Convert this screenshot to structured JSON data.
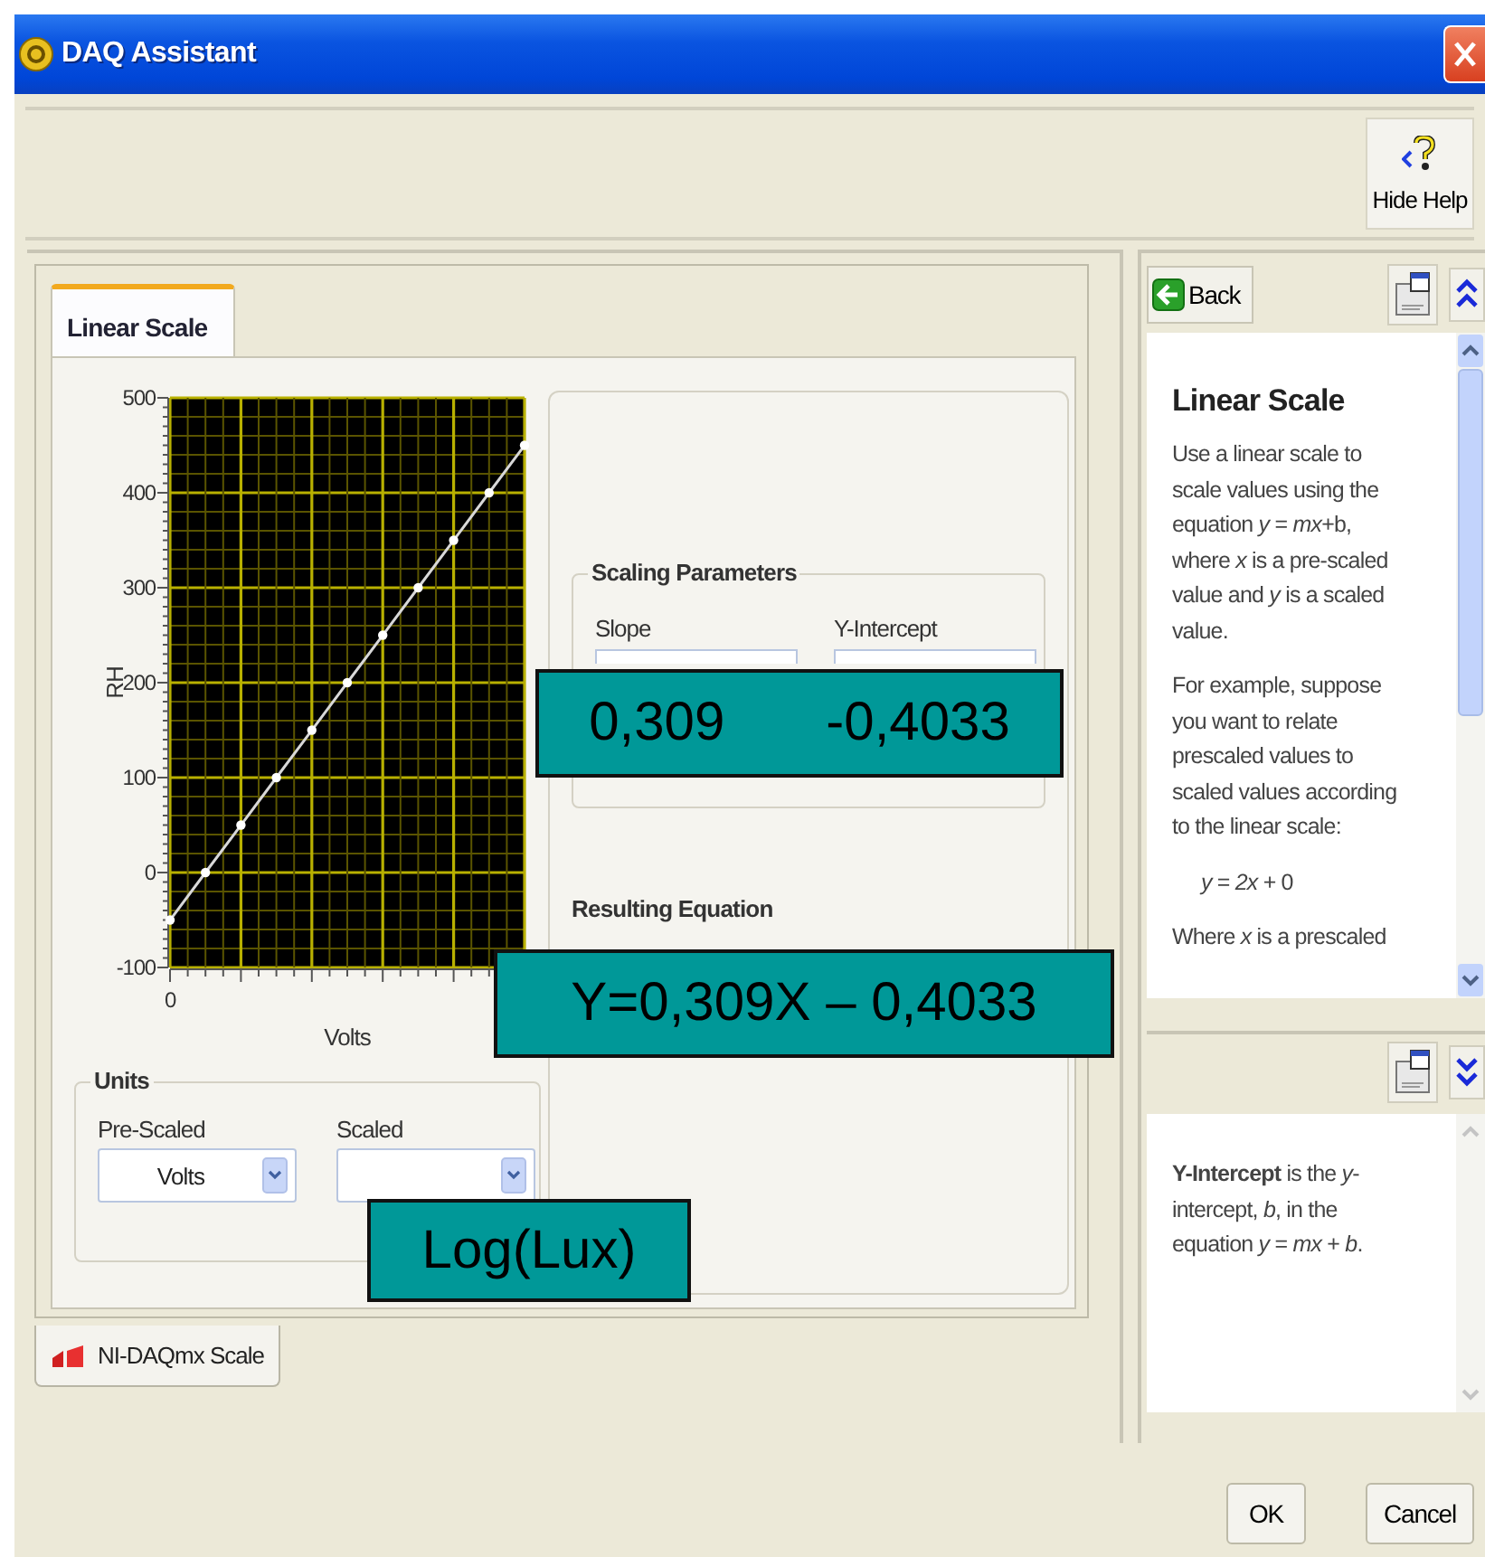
{
  "window": {
    "title": "DAQ Assistant"
  },
  "toolbar": {
    "hide_help_button": "Hide Help"
  },
  "tabs": [
    {
      "label": "Linear Scale",
      "selected": true
    }
  ],
  "chart": {
    "x_start_label": "0",
    "chart_data": {
      "type": "line",
      "xlabel": "Volts",
      "ylabel": "RH",
      "ylim": [
        -100,
        500
      ],
      "yticks": [
        -100,
        0,
        100,
        200,
        300,
        400,
        500
      ],
      "grid": true,
      "series": [
        {
          "color": "#d8d8d8",
          "marker": "circle",
          "values": [
            -50,
            0,
            50,
            100,
            150,
            200,
            250,
            300,
            350,
            400,
            450
          ]
        }
      ]
    }
  },
  "scaling_parameters": {
    "title": "Scaling Parameters",
    "slope_label": "Slope",
    "intercept_label": "Y-Intercept"
  },
  "resulting_equation": {
    "title": "Resulting Equation"
  },
  "units": {
    "title": "Units",
    "pre_scaled": {
      "label": "Pre-Scaled",
      "value": "Volts"
    },
    "scaled": {
      "label": "Scaled"
    }
  },
  "bottom_tabs": [
    {
      "label": "NI-DAQmx Scale",
      "selected": true
    }
  ],
  "help": {
    "back_button": "Back",
    "title": "Linear Scale",
    "paragraphs": [
      "Use a linear scale to scale values using the equation *y* = *mx*+b, where *x* is a pre-scaled value and *y* is a scaled value.",
      "For example, suppose you want to relate prescaled values to scaled values according to the linear scale:",
      "*y* = *2x* + 0",
      "Where *x* is a prescaled"
    ],
    "lower_text": "**Y-Intercept** is the *y*-intercept, *b*, in the equation *y* = *mx* + *b*."
  },
  "callouts": [
    {
      "kind": "pair",
      "texts": [
        "0,309",
        "-0,4033"
      ]
    },
    {
      "kind": "single",
      "texts": [
        "Y=0,309X – 0,4033"
      ]
    },
    {
      "kind": "single",
      "texts": [
        "Log(Lux)"
      ]
    }
  ],
  "buttons": [
    "OK",
    "Cancel"
  ]
}
